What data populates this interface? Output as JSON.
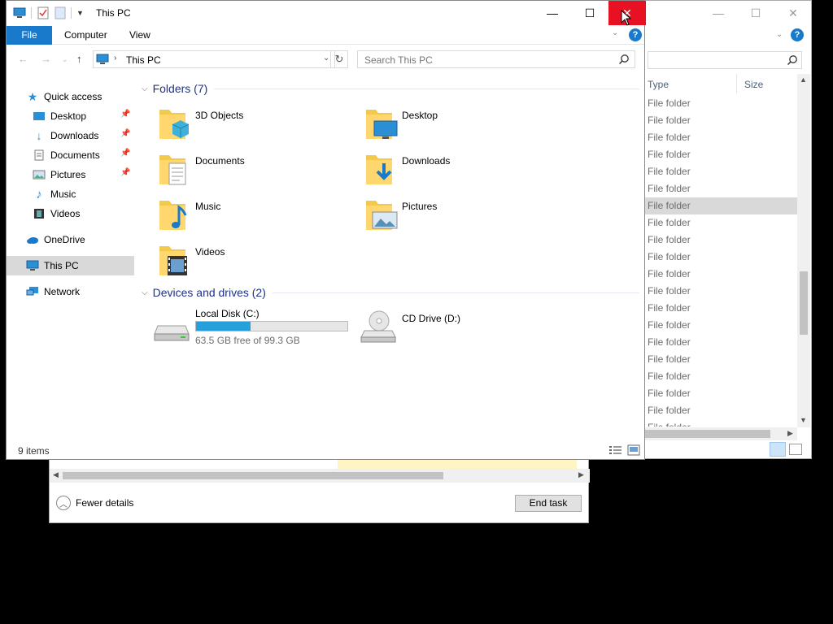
{
  "main_window": {
    "title": "This PC",
    "ribbon": {
      "file": "File",
      "computer": "Computer",
      "view": "View",
      "help": "?"
    },
    "controls": {
      "minimize": "—",
      "maximize": "☐",
      "close": "✕"
    },
    "address": {
      "path": "This PC",
      "refresh": "↻"
    },
    "search": {
      "placeholder": "Search This PC"
    },
    "nav": {
      "quick_access": "Quick access",
      "desktop": "Desktop",
      "downloads": "Downloads",
      "documents": "Documents",
      "pictures": "Pictures",
      "music": "Music",
      "videos": "Videos",
      "onedrive": "OneDrive",
      "this_pc": "This PC",
      "network": "Network"
    },
    "folders_header": "Folders (7)",
    "folders": [
      {
        "label": "3D Objects"
      },
      {
        "label": "Desktop"
      },
      {
        "label": "Documents"
      },
      {
        "label": "Downloads"
      },
      {
        "label": "Music"
      },
      {
        "label": "Pictures"
      },
      {
        "label": "Videos"
      }
    ],
    "drives_header": "Devices and drives (2)",
    "drives": {
      "c": {
        "label": "Local Disk (C:)",
        "free": "63.5 GB free of 99.3 GB",
        "used_fraction": 0.36
      },
      "d": {
        "label": "CD Drive (D:)"
      }
    },
    "status": "9 items"
  },
  "back_window": {
    "columns": {
      "type": "Type",
      "size": "Size"
    },
    "rows": [
      "File folder",
      "File folder",
      "File folder",
      "File folder",
      "File folder",
      "File folder",
      "File folder",
      "File folder",
      "File folder",
      "File folder",
      "File folder",
      "File folder",
      "File folder",
      "File folder",
      "File folder",
      "File folder",
      "File folder",
      "File folder",
      "File folder",
      "File folder"
    ],
    "selected_row": 6
  },
  "task_manager": {
    "fewer_details": "Fewer details",
    "end_task": "End task"
  },
  "colors": {
    "accent": "#1979ca",
    "close_red": "#e81123",
    "drive_bar": "#26a0da",
    "group_header": "#1e3287"
  }
}
